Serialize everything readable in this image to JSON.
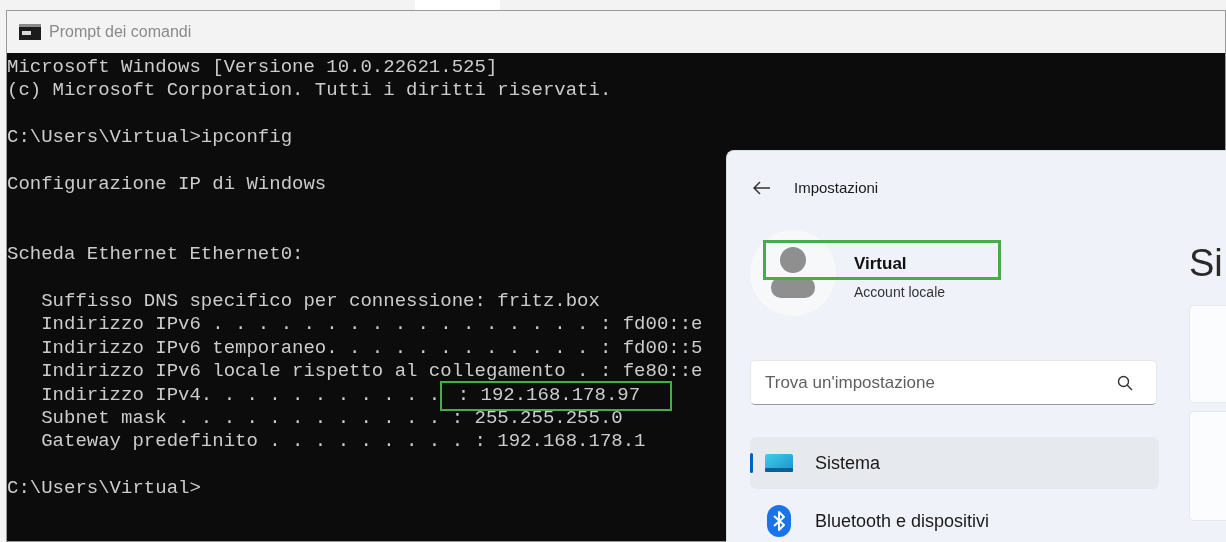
{
  "cmd_window": {
    "title": "Prompt dei comandi",
    "blocks": [
      {
        "kind": "text",
        "lines": [
          "Microsoft Windows [Versione 10.0.22621.525]",
          "(c) Microsoft Corporation. Tutti i diritti riservati."
        ]
      },
      {
        "kind": "text",
        "lines": [
          "C:\\Users\\Virtual>ipconfig"
        ]
      },
      {
        "kind": "text",
        "lines": [
          "Configurazione IP di Windows"
        ]
      },
      {
        "kind": "section",
        "lines": [
          "Scheda Ethernet Ethernet0:"
        ]
      },
      {
        "kind": "text",
        "lines": [
          "   Suffisso DNS specifico per connessione: fritz.box",
          "   Indirizzo IPv6 . . . . . . . . . . . . . . . . . : fd00::e",
          "   Indirizzo IPv6 temporaneo. . . . . . . . . . . . : fd00::5",
          "   Indirizzo IPv6 locale rispetto al collegamento . : fe80::e",
          {
            "text": "   Indirizzo IPv4. . . . . . . . . . .",
            "highlighted_value": " : 192.168.178.97"
          },
          "   Subnet mask . . . . . . . . . . . . : 255.255.255.0",
          "   Gateway predefinito . . . . . . . . . : 192.168.178.1"
        ]
      },
      {
        "kind": "text",
        "lines": [
          "C:\\Users\\Virtual>"
        ]
      }
    ]
  },
  "settings_window": {
    "title": "Impostazioni",
    "user": {
      "name": "Virtual",
      "account_type": "Account locale"
    },
    "search": {
      "placeholder": "Trova un'impostazione"
    },
    "nav_items": [
      {
        "label": "Sistema",
        "selected": true,
        "kind": "system"
      },
      {
        "label": "Bluetooth e dispositivi",
        "selected": false,
        "kind": "bluetooth"
      }
    ],
    "page_heading": "Si"
  }
}
